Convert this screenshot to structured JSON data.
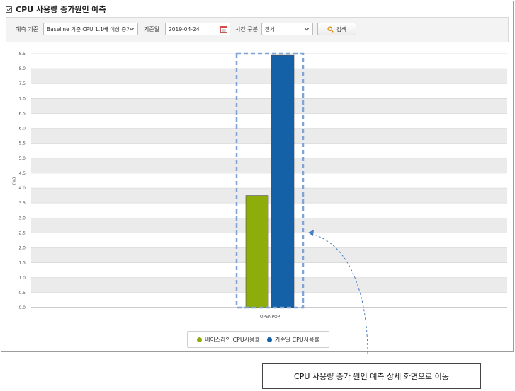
{
  "title": "CPU 사용량 증가원인 예측",
  "filters": {
    "prediction_label": "예측 기준",
    "prediction_value": "Baseline 기준 CPU 1.1배 이상 증가",
    "date_label": "기준일",
    "date_value": "2019-04-24",
    "time_label": "시간 구분",
    "time_value": "전체",
    "search_label": "검색"
  },
  "chart_data": {
    "type": "bar",
    "categories": [
      "OPENPOP"
    ],
    "series": [
      {
        "name": "베이스라인 CPU사용률",
        "values": [
          3.75
        ],
        "color": "#8fad0a"
      },
      {
        "name": "기준일 CPU사용률",
        "values": [
          8.45
        ],
        "color": "#1561a8"
      }
    ],
    "ylabel": "(%)",
    "ylim": [
      0,
      8.5
    ],
    "yticks": [
      "0.0",
      "0.5",
      "1.0",
      "1.5",
      "2.0",
      "2.5",
      "3.0",
      "3.5",
      "4.0",
      "4.5",
      "5.0",
      "5.5",
      "6.0",
      "6.5",
      "7.0",
      "7.5",
      "8.0",
      "8.5"
    ],
    "grid": true,
    "legend": "bottom-center"
  },
  "colors": {
    "highlight_dash": "#7fa4d6",
    "callout_arrow": "#4a7fc1"
  },
  "callout_text": "CPU 사용량 증가 원인 예측 상세 화면으로 이동"
}
